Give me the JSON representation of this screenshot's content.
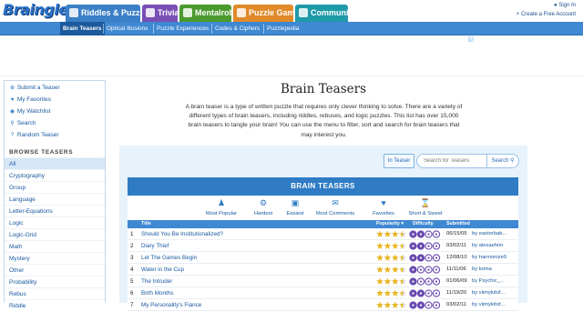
{
  "header": {
    "logo": "Braingle",
    "nav": [
      {
        "label": "Riddles & Puzzles",
        "color": "#3b7fc7",
        "icon": "riddles-icon"
      },
      {
        "label": "Trivia",
        "color": "#7a4fb5",
        "icon": "trivia-icon"
      },
      {
        "label": "Mentalrobics",
        "color": "#4a9a2e",
        "icon": "mentalrobics-icon"
      },
      {
        "label": "Puzzle Games",
        "color": "#e08a2a",
        "icon": "puzzle-games-icon"
      },
      {
        "label": "Community",
        "color": "#1f9aa8",
        "icon": "community-icon"
      }
    ],
    "sign_in": "Sign In",
    "create_account": "Create a Free Account"
  },
  "subnav": [
    "Brain Teasers",
    "Optical Illusions",
    "Puzzle Experiences",
    "Codes & Ciphers",
    "Puzzlepedia"
  ],
  "sidebar": {
    "links": [
      {
        "label": "Submit a Teaser",
        "icon": "plus-circle-icon"
      },
      {
        "label": "My Favorites",
        "icon": "heart-icon"
      },
      {
        "label": "My Watchlist",
        "icon": "eye-icon"
      },
      {
        "label": "Search",
        "icon": "search-icon"
      },
      {
        "label": "Random Teaser",
        "icon": "question-icon"
      }
    ],
    "heading": "BROWSE TEASERS",
    "categories": [
      "All",
      "Cryptography",
      "Group",
      "Language",
      "Letter-Equations",
      "Logic",
      "Logic-Grid",
      "Math",
      "Mystery",
      "Other",
      "Probability",
      "Rebus",
      "Riddle"
    ]
  },
  "main": {
    "title": "Brain Teasers",
    "intro": "A brain teaser is a type of written puzzle that requires only clever thinking to solve. There are a variety of different types of brain teasers, including riddles, rebuses, and logic puzzles. This list has over 15,000 brain teasers to tangle your brain! You can use the menu to filter, sort and search for brain teasers that may interest you.",
    "in_teaser": "In Teaser",
    "search_placeholder": "Search for Teasers",
    "search_button": "Search",
    "panel_title": "BRAIN TEASERS",
    "sorts": [
      {
        "label": "Most Popular",
        "icon": "users-icon"
      },
      {
        "label": "Hardest",
        "icon": "gears-icon"
      },
      {
        "label": "Easiest",
        "icon": "cube-icon"
      },
      {
        "label": "Most Comments",
        "icon": "comments-icon"
      },
      {
        "label": "Favorites",
        "icon": "heart-icon"
      },
      {
        "label": "Short & Sweet",
        "icon": "hourglass-icon"
      }
    ],
    "columns": {
      "title": "Title",
      "popularity": "Popularity ▾",
      "difficulty": "Difficulty",
      "submitted": "Submitted"
    },
    "rows": [
      {
        "num": "1",
        "title": "Should You Be Institutionalized?",
        "stars": 3.5,
        "difficulty": 2,
        "date": "06/15/05",
        "by": "by easterbab..."
      },
      {
        "num": "2",
        "title": "Diary Thief",
        "stars": 3.5,
        "difficulty": 2,
        "date": "03/02/11",
        "by": "by alexaehrin"
      },
      {
        "num": "3",
        "title": "Let The Games Begin",
        "stars": 3.5,
        "difficulty": 2,
        "date": "12/08/10",
        "by": "by harmonize9"
      },
      {
        "num": "4",
        "title": "Water in the Cup",
        "stars": 3.5,
        "difficulty": 1,
        "date": "11/11/06",
        "by": "by koma"
      },
      {
        "num": "5",
        "title": "The Intruder",
        "stars": 3.5,
        "difficulty": 1,
        "date": "01/06/09",
        "by": "by Psychic_..."
      },
      {
        "num": "6",
        "title": "Birth Months",
        "stars": 3.5,
        "difficulty": 2,
        "date": "11/19/20",
        "by": "by viimykitof..."
      },
      {
        "num": "7",
        "title": "My Personality's Fiance",
        "stars": 3.5,
        "difficulty": 2,
        "date": "03/02/11",
        "by": "by viimykitof..."
      }
    ]
  },
  "colors": {
    "primary": "#2f7bc4",
    "star": "#e9b620",
    "difficulty": "#6a4bb0",
    "panel": "#e7f2fb"
  }
}
